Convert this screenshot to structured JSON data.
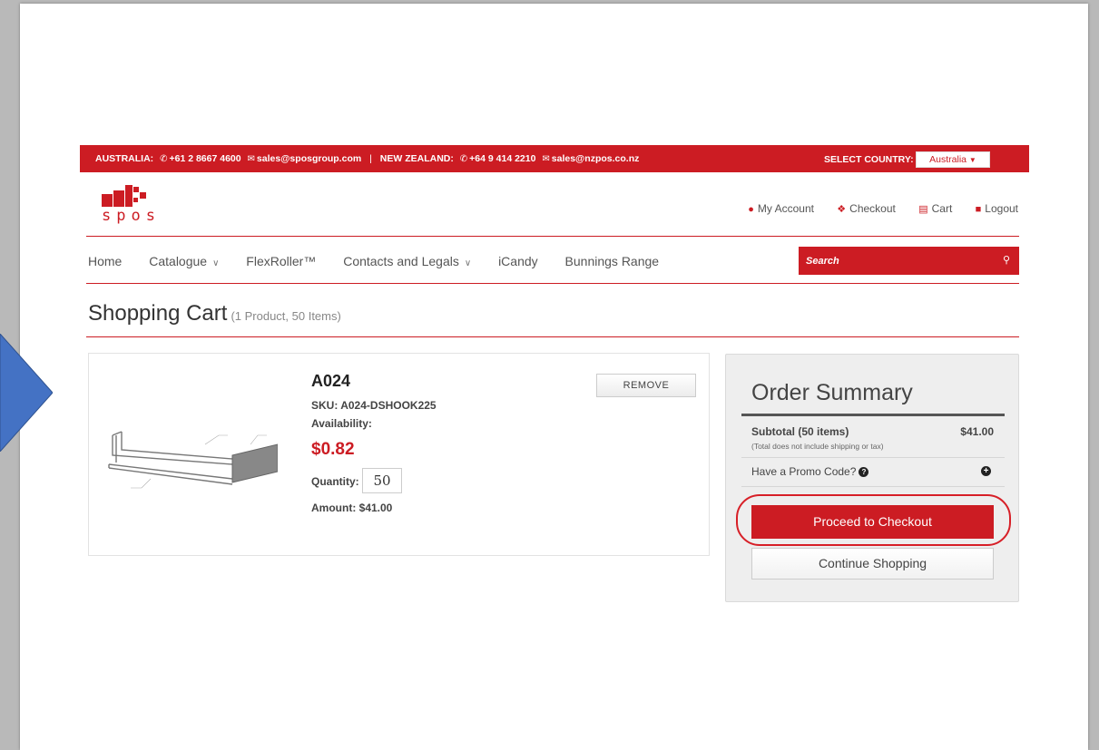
{
  "topbar": {
    "australia_label": "AUSTRALIA:",
    "australia_phone": "+61 2 8667 4600",
    "australia_email": "sales@sposgroup.com",
    "separator": "|",
    "nz_label": "NEW ZEALAND:",
    "nz_phone": "+64 9 414 2210",
    "nz_email": "sales@nzpos.co.nz",
    "select_country_label": "SELECT COUNTRY:",
    "country_value": "Australia"
  },
  "logo": {
    "text": "spos"
  },
  "account": {
    "my_account": "My Account",
    "checkout": "Checkout",
    "cart": "Cart",
    "logout": "Logout"
  },
  "nav": {
    "home": "Home",
    "catalogue": "Catalogue",
    "flexroller": "FlexRoller™",
    "contacts": "Contacts and Legals",
    "icandy": "iCandy",
    "bunnings": "Bunnings Range"
  },
  "search": {
    "placeholder": "Search"
  },
  "cart": {
    "title": "Shopping Cart",
    "subtitle": "(1 Product, 50 Items)"
  },
  "product": {
    "name": "A024",
    "sku": "SKU: A024-DSHOOK225",
    "availability": "Availability:",
    "price": "$0.82",
    "quantity_label": "Quantity:",
    "quantity": "50",
    "amount": "Amount: $41.00",
    "remove_label": "REMOVE"
  },
  "summary": {
    "title": "Order Summary",
    "subtotal_label": "Subtotal (50 items)",
    "subtotal_value": "$41.00",
    "note": "(Total does not include shipping or tax)",
    "promo_label": "Have a Promo Code?",
    "checkout_label": "Proceed to Checkout",
    "continue_label": "Continue Shopping"
  },
  "colors": {
    "brand_red": "#cc1c23",
    "annotation_blue": "#4472c4"
  }
}
